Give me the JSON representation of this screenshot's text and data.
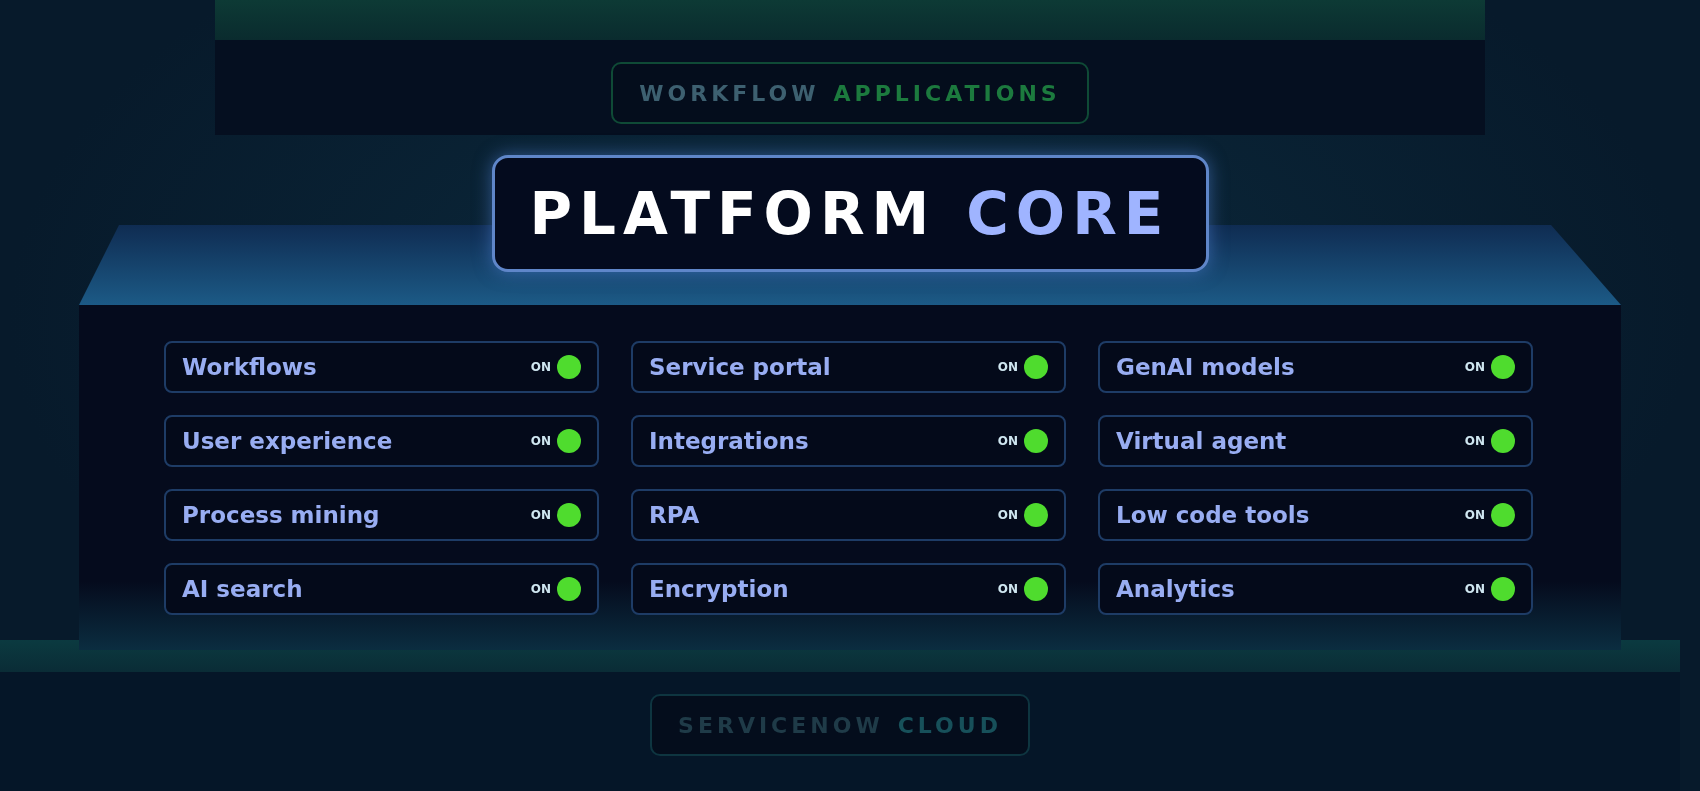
{
  "top_tier": {
    "label": [
      {
        "text": "WORKFLOW",
        "accent": false
      },
      {
        "text": "APPLICATIONS",
        "accent": true
      }
    ]
  },
  "platform": {
    "title": [
      {
        "text": "PLATFORM",
        "accent": false
      },
      {
        "text": "CORE",
        "accent": true
      }
    ],
    "columns": [
      [
        {
          "label": "Workflows",
          "status": "ON",
          "on": true
        },
        {
          "label": "User experience",
          "status": "ON",
          "on": true
        },
        {
          "label": "Process mining",
          "status": "ON",
          "on": true
        },
        {
          "label": "AI search",
          "status": "ON",
          "on": true
        }
      ],
      [
        {
          "label": "Service portal",
          "status": "ON",
          "on": true
        },
        {
          "label": "Integrations",
          "status": "ON",
          "on": true
        },
        {
          "label": "RPA",
          "status": "ON",
          "on": true
        },
        {
          "label": "Encryption",
          "status": "ON",
          "on": true
        }
      ],
      [
        {
          "label": "GenAI models",
          "status": "ON",
          "on": true
        },
        {
          "label": "Virtual agent",
          "status": "ON",
          "on": true
        },
        {
          "label": "Low code tools",
          "status": "ON",
          "on": true
        },
        {
          "label": "Analytics",
          "status": "ON",
          "on": true
        }
      ]
    ]
  },
  "bottom_tier": {
    "label": [
      {
        "text": "SERVICENOW",
        "accent": false
      },
      {
        "text": "CLOUD",
        "accent": true
      }
    ]
  }
}
